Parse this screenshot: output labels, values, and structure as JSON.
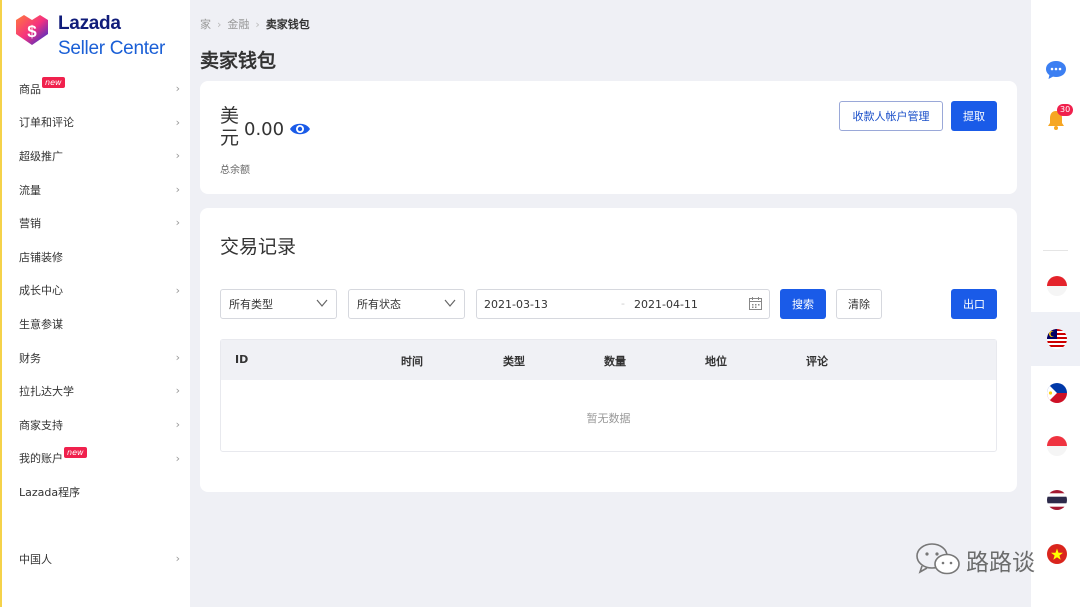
{
  "brand": {
    "name": "Lazada",
    "subtitle": "Seller Center"
  },
  "sidebar": {
    "items": [
      {
        "label": "商品",
        "badge": "new",
        "chevron": true
      },
      {
        "label": "订单和评论",
        "chevron": true
      },
      {
        "label": "超级推广",
        "chevron": true
      },
      {
        "label": "流量",
        "chevron": true
      },
      {
        "label": "营销",
        "chevron": true
      },
      {
        "label": "店铺装修",
        "chevron": false
      },
      {
        "label": "成长中心",
        "chevron": true
      },
      {
        "label": "生意参谋",
        "chevron": false
      },
      {
        "label": "财务",
        "chevron": true
      },
      {
        "label": "拉扎达大学",
        "chevron": true
      },
      {
        "label": "商家支持",
        "chevron": true
      },
      {
        "label": "我的账户",
        "badge": "new",
        "chevron": true
      },
      {
        "label": "Lazada程序",
        "chevron": false
      }
    ],
    "language": {
      "label": "中国人"
    }
  },
  "breadcrumb": {
    "home": "家",
    "finance": "金融",
    "current": "卖家钱包"
  },
  "page_title": "卖家钱包",
  "balance": {
    "currency": "美元",
    "amount": "0.00",
    "label": "总余额",
    "payee_button": "收款人帐户管理",
    "withdraw_button": "提取"
  },
  "transactions": {
    "title": "交易记录",
    "type_select": "所有类型",
    "status_select": "所有状态",
    "date_start": "2021-03-13",
    "date_separator": "-",
    "date_end": "2021-04-11",
    "search_button": "搜索",
    "clear_button": "清除",
    "export_button": "出口",
    "columns": [
      "ID",
      "时间",
      "类型",
      "数量",
      "地位",
      "评论"
    ],
    "empty_text": "暂无数据"
  },
  "rail": {
    "notification_count": "30",
    "flags": [
      "indonesia",
      "malaysia",
      "philippines",
      "singapore",
      "thailand",
      "vietnam"
    ]
  },
  "watermark": {
    "text": "路路谈"
  },
  "colors": {
    "primary": "#1a5be8",
    "brand_dark": "#101c7a",
    "badge": "#f0214d",
    "background": "#eff0f5"
  }
}
